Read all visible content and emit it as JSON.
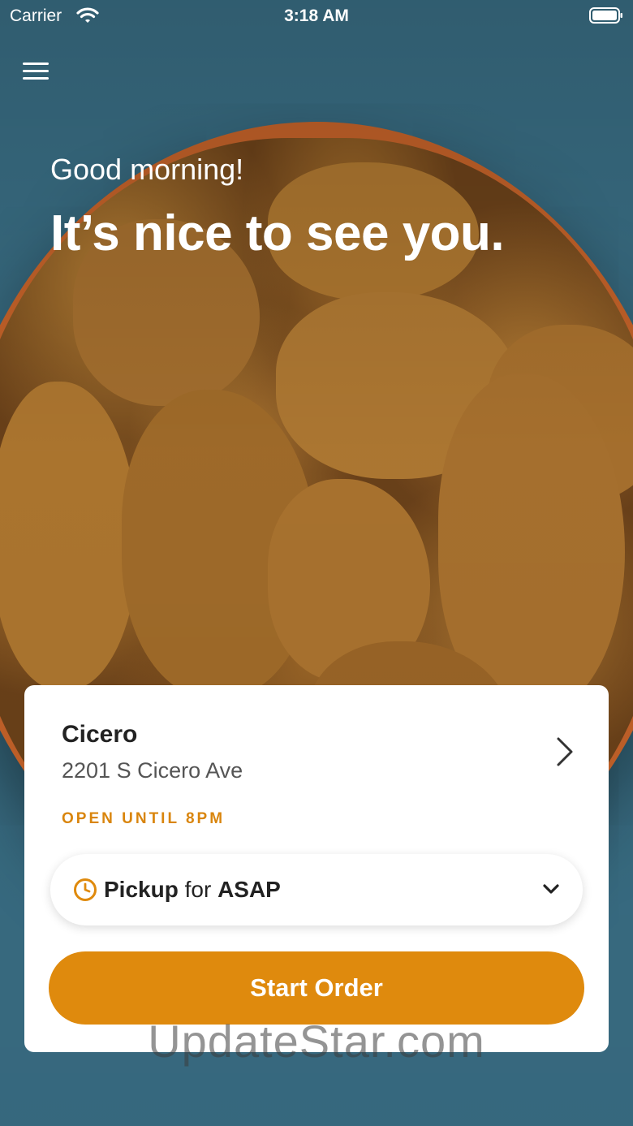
{
  "status_bar": {
    "carrier": "Carrier",
    "time": "3:18 AM"
  },
  "header": {
    "greeting": "Good morning!",
    "headline": "It’s nice to see you."
  },
  "store_card": {
    "name": "Cicero",
    "address": "2201 S Cicero Ave",
    "hours": "OPEN UNTIL 8PM",
    "pickup": {
      "method": "Pickup",
      "connector": "for",
      "time": "ASAP"
    },
    "start_order_label": "Start Order"
  },
  "watermark": "UpdateStar.com",
  "colors": {
    "background": "#3b7188",
    "accent": "#df8a0d",
    "card": "#ffffff"
  },
  "icons": {
    "menu": "menu-icon",
    "wifi": "wifi-icon",
    "battery": "battery-icon",
    "chevron_right": "chevron-right-icon",
    "clock": "clock-icon",
    "chevron_down": "chevron-down-icon"
  }
}
